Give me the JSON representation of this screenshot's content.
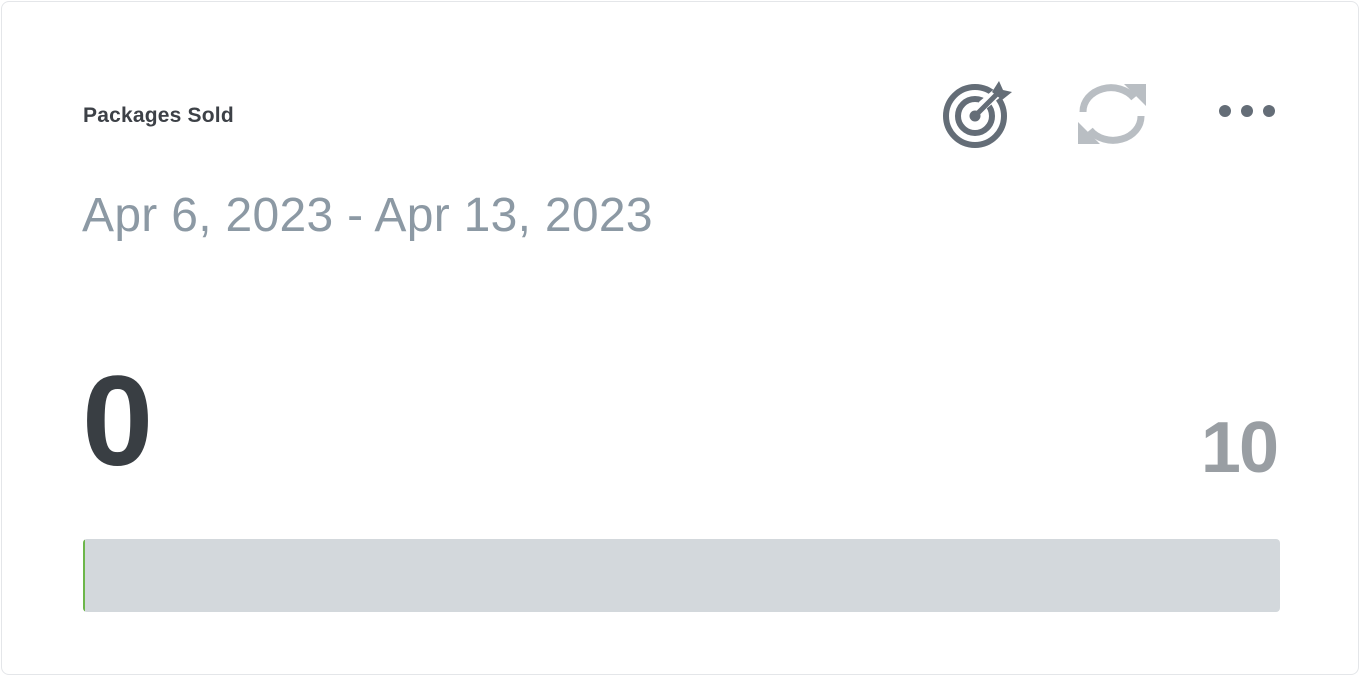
{
  "widget": {
    "title": "Packages Sold",
    "date_range": "Apr 6, 2023 - Apr 13, 2023",
    "current_value": "0",
    "goal_value": "10",
    "progress_fraction": 0.0
  },
  "toolbar": {
    "icons": [
      "target-icon",
      "refresh-icon",
      "more-options-icon"
    ]
  },
  "colors": {
    "progress_fill": "#6cb64a",
    "progress_track": "#d3d8dc",
    "icon_dark": "#646d77",
    "icon_light": "#b9bec3"
  }
}
